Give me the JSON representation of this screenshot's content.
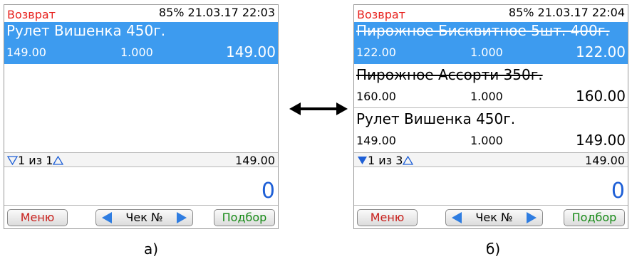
{
  "screens": {
    "a": {
      "status_label": "Возврат",
      "status_info": "85% 21.03.17 22:03",
      "items": [
        {
          "name": "Рулет Вишенка 450г.",
          "price": "149.00",
          "qty": "1.000",
          "sum": "149.00"
        }
      ],
      "pager": {
        "text": "1 из 1",
        "total": "149.00"
      },
      "amount": "0",
      "softkeys": {
        "menu": "Меню",
        "check": "Чек №",
        "select": "Подбор"
      }
    },
    "b": {
      "status_label": "Возврат",
      "status_info": "85% 21.03.17 22:04",
      "items": [
        {
          "name": "Пирожное Бисквитное 5шт. 400г.",
          "price": "122.00",
          "qty": "1.000",
          "sum": "122.00"
        },
        {
          "name": "Пирожное Ассорти 350г.",
          "price": "160.00",
          "qty": "1.000",
          "sum": "160.00"
        },
        {
          "name": "Рулет Вишенка 450г.",
          "price": "149.00",
          "qty": "1.000",
          "sum": "149.00"
        }
      ],
      "pager": {
        "text": "1 из 3",
        "total": "149.00"
      },
      "amount": "0",
      "softkeys": {
        "menu": "Меню",
        "check": "Чек №",
        "select": "Подбор"
      }
    }
  },
  "captions": {
    "a": "а)",
    "b": "б)"
  },
  "colors": {
    "selection": "#3d9bef",
    "status_label": "#e8231f",
    "amount": "#1e5fd6",
    "triangle": "#1e5fd6"
  }
}
